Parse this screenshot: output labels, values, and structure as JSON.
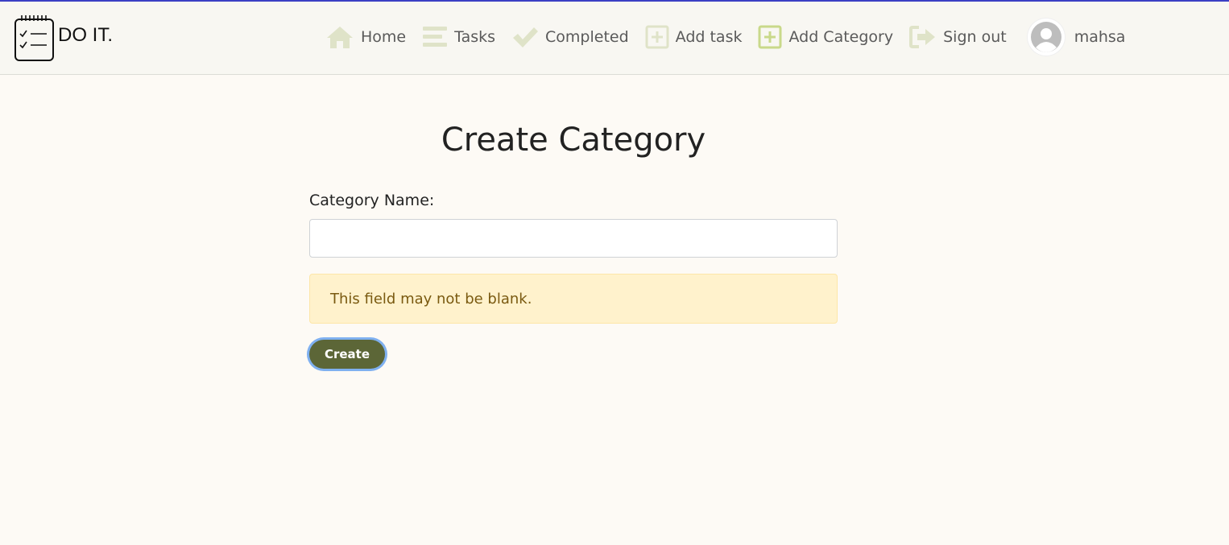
{
  "brand": {
    "name": "DO IT.",
    "logo_icon": "checklist-notepad-icon"
  },
  "nav": {
    "items": [
      {
        "label": "Home",
        "icon": "home-icon"
      },
      {
        "label": "Tasks",
        "icon": "list-icon"
      },
      {
        "label": "Completed",
        "icon": "checkmark-icon"
      },
      {
        "label": "Add task",
        "icon": "plus-square-icon"
      },
      {
        "label": "Add Category",
        "icon": "plus-square-icon"
      },
      {
        "label": "Sign out",
        "icon": "sign-out-icon"
      }
    ],
    "user": {
      "name": "mahsa",
      "icon": "user-avatar-icon"
    }
  },
  "page": {
    "title": "Create Category"
  },
  "form": {
    "category_label": "Category Name:",
    "category_value": "",
    "error": "This field may not be blank.",
    "submit_label": "Create"
  },
  "colors": {
    "accent_bar": "#3b3fc4",
    "nav_icon": "#dfe3c8",
    "nav_icon_active": "#c9d98a",
    "button": "#5c6637",
    "alert_bg": "#fff2cc"
  }
}
